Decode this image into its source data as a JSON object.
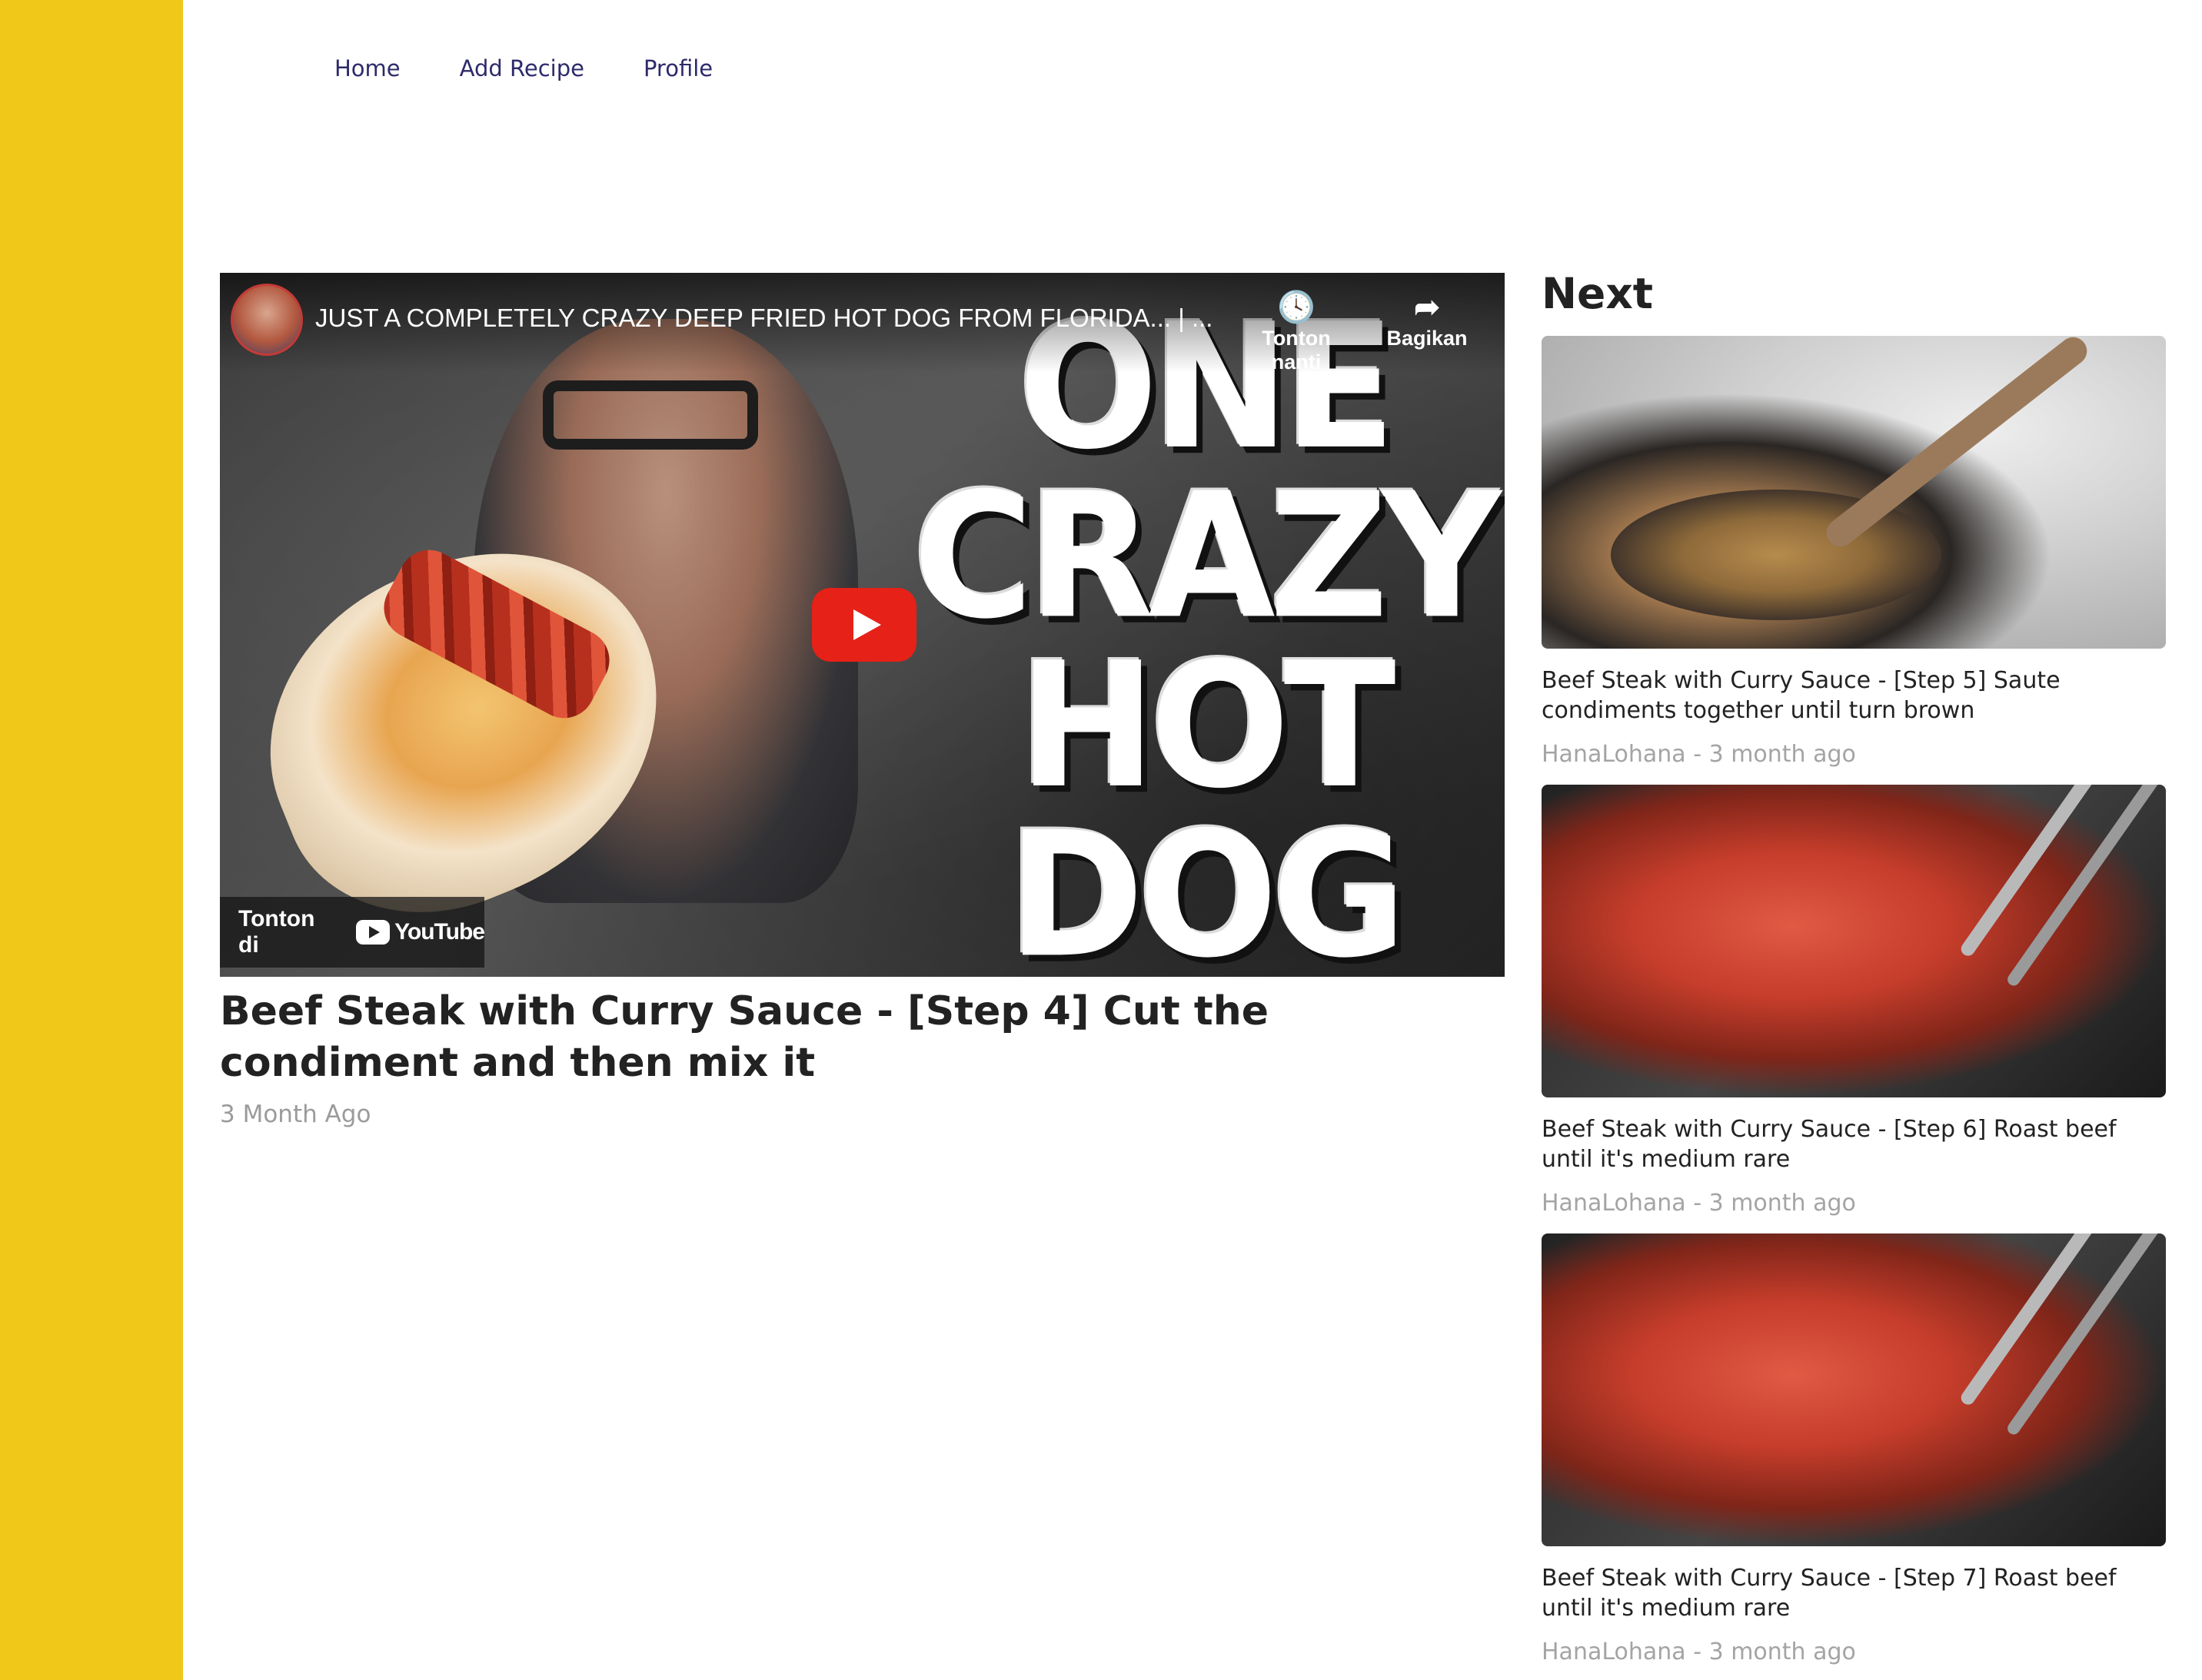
{
  "nav": {
    "items": [
      {
        "label": "Home"
      },
      {
        "label": "Add Recipe"
      },
      {
        "label": "Profile"
      }
    ]
  },
  "video": {
    "title": "JUST A COMPLETELY CRAZY DEEP FRIED HOT DOG FROM FLORIDA... | ...",
    "watch_later_label": "Tonton nanti",
    "share_label": "Bagikan",
    "thumbnail_text": "ONE CRAZY HOT DOG",
    "watch_on_label": "Tonton di",
    "youtube_label": "YouTube"
  },
  "main": {
    "title": "Beef Steak with Curry Sauce - [Step 4] Cut the condiment and then mix it",
    "meta": "3 Month Ago"
  },
  "next": {
    "heading": "Next",
    "items": [
      {
        "title": "Beef Steak with Curry Sauce - [Step 5] Saute condiments together until turn brown",
        "meta": "HanaLohana - 3 month ago",
        "thumb": "pan"
      },
      {
        "title": "Beef Steak with Curry Sauce - [Step 6] Roast beef until it's medium rare",
        "meta": "HanaLohana - 3 month ago",
        "thumb": "beef"
      },
      {
        "title": "Beef Steak with Curry Sauce - [Step 7] Roast beef until it's medium rare",
        "meta": "HanaLohana - 3 month ago",
        "thumb": "beef"
      }
    ]
  },
  "colors": {
    "sidebar": "#efc81a",
    "nav_text": "#2e2a6b",
    "heading_text": "#222222",
    "meta_text": "#9b9b9b",
    "youtube_red": "#e62117"
  }
}
